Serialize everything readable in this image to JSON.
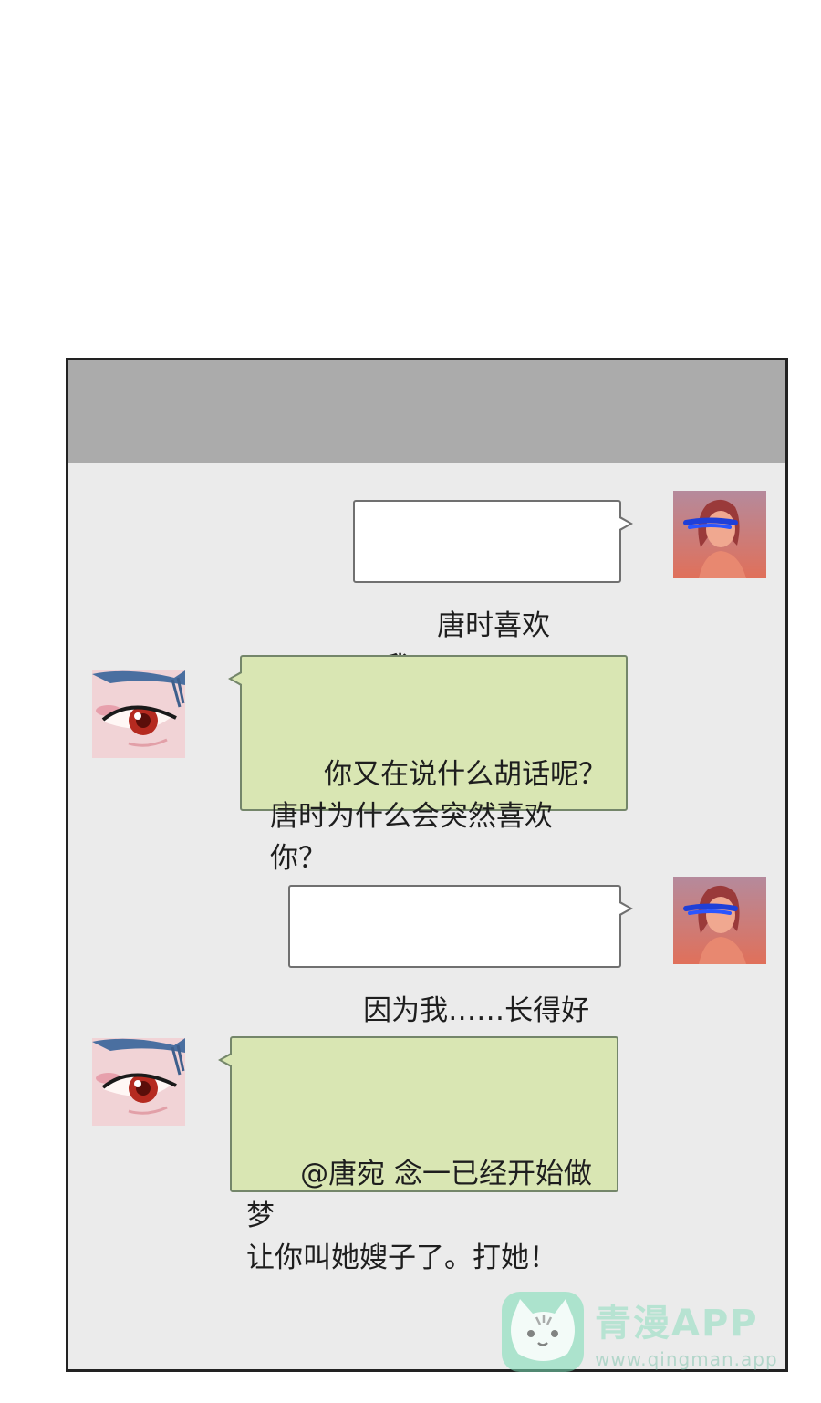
{
  "messages": [
    {
      "side": "right",
      "avatar": "girl-avatar-icon",
      "text": "唐时喜欢我！！"
    },
    {
      "side": "left",
      "avatar": "eye-avatar-icon",
      "text": "你又在说什么胡话呢？\n唐时为什么会突然喜欢\n你？"
    },
    {
      "side": "right",
      "avatar": "girl-avatar-icon",
      "text": "因为我……长得好看？"
    },
    {
      "side": "left",
      "avatar": "eye-avatar-icon",
      "text": "@唐宛 念一已经开始做梦\n让你叫她嫂子了。打她！"
    }
  ],
  "watermark": {
    "title": "青漫APP",
    "url": "www.qingman.app"
  },
  "colors": {
    "title_bar": "#ababab",
    "chat_bg": "#ebebeb",
    "bubble_right": "#ffffff",
    "bubble_left": "#d9e6b3",
    "frame_border": "#222222"
  }
}
